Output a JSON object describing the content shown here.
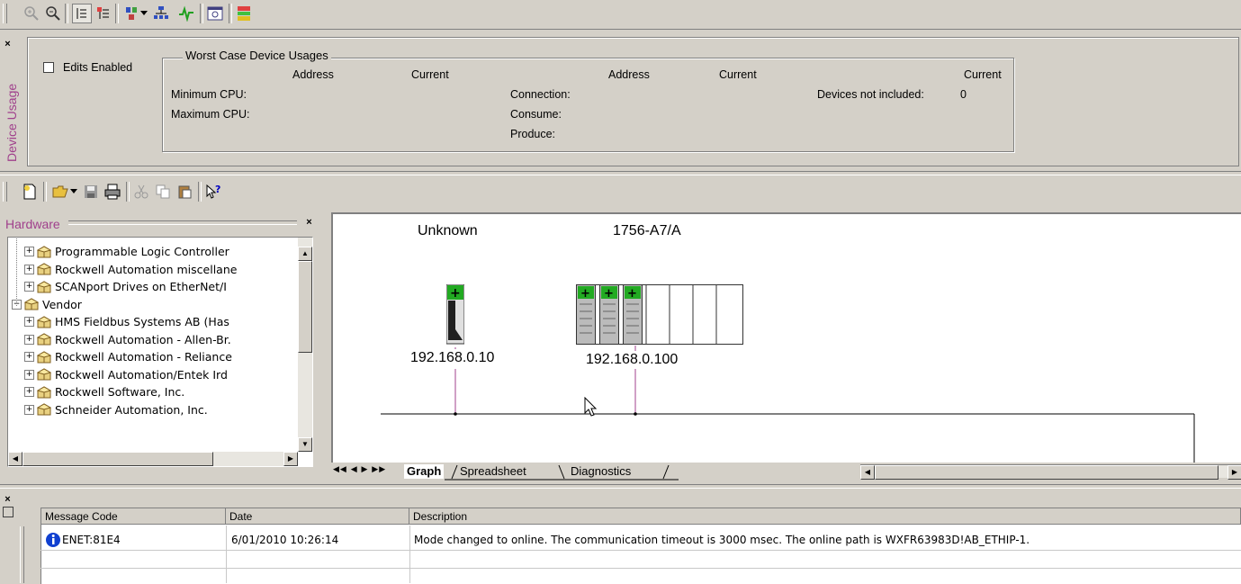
{
  "device_usage": {
    "side_label": "Device Usage",
    "edits_enabled_label": "Edits Enabled",
    "group_title": "Worst Case Device Usages",
    "col_address": "Address",
    "col_current": "Current",
    "min_cpu": "Minimum CPU:",
    "max_cpu": "Maximum CPU:",
    "connection": "Connection:",
    "consume": "Consume:",
    "produce": "Produce:",
    "devices_not_included": "Devices not included:",
    "devices_not_included_value": "0"
  },
  "hardware": {
    "title": "Hardware",
    "items": [
      {
        "label": "Programmable Logic Controller",
        "indent": 2
      },
      {
        "label": "Rockwell Automation miscellane",
        "indent": 2
      },
      {
        "label": "SCANport Drives on EtherNet/I",
        "indent": 2
      },
      {
        "label": "Vendor",
        "indent": 1
      },
      {
        "label": "HMS Fieldbus Systems AB (Has",
        "indent": 2
      },
      {
        "label": "Rockwell Automation - Allen-Br.",
        "indent": 2
      },
      {
        "label": "Rockwell Automation - Reliance",
        "indent": 2
      },
      {
        "label": "Rockwell Automation/Entek Ird",
        "indent": 2
      },
      {
        "label": "Rockwell Software, Inc.",
        "indent": 2
      },
      {
        "label": "Schneider Automation, Inc.",
        "indent": 2
      }
    ]
  },
  "graph": {
    "device1_name": "Unknown",
    "device1_ip": "192.168.0.10",
    "device2_name": "1756-A7/A",
    "device2_ip": "192.168.0.100",
    "tabs": [
      "Graph",
      "Spreadsheet",
      "Diagnostics"
    ]
  },
  "messages": {
    "headers": [
      "Message Code",
      "Date",
      "Description"
    ],
    "rows": [
      {
        "code": "ENET:81E4",
        "date": "6/01/2010 10:26:14",
        "description": "Mode changed to online. The communication timeout is 3000 msec. The online path is WXFR63983D!AB_ETHIP-1."
      }
    ]
  },
  "colors": {
    "accent": "#a0408c",
    "module_green": "#22aa22"
  }
}
